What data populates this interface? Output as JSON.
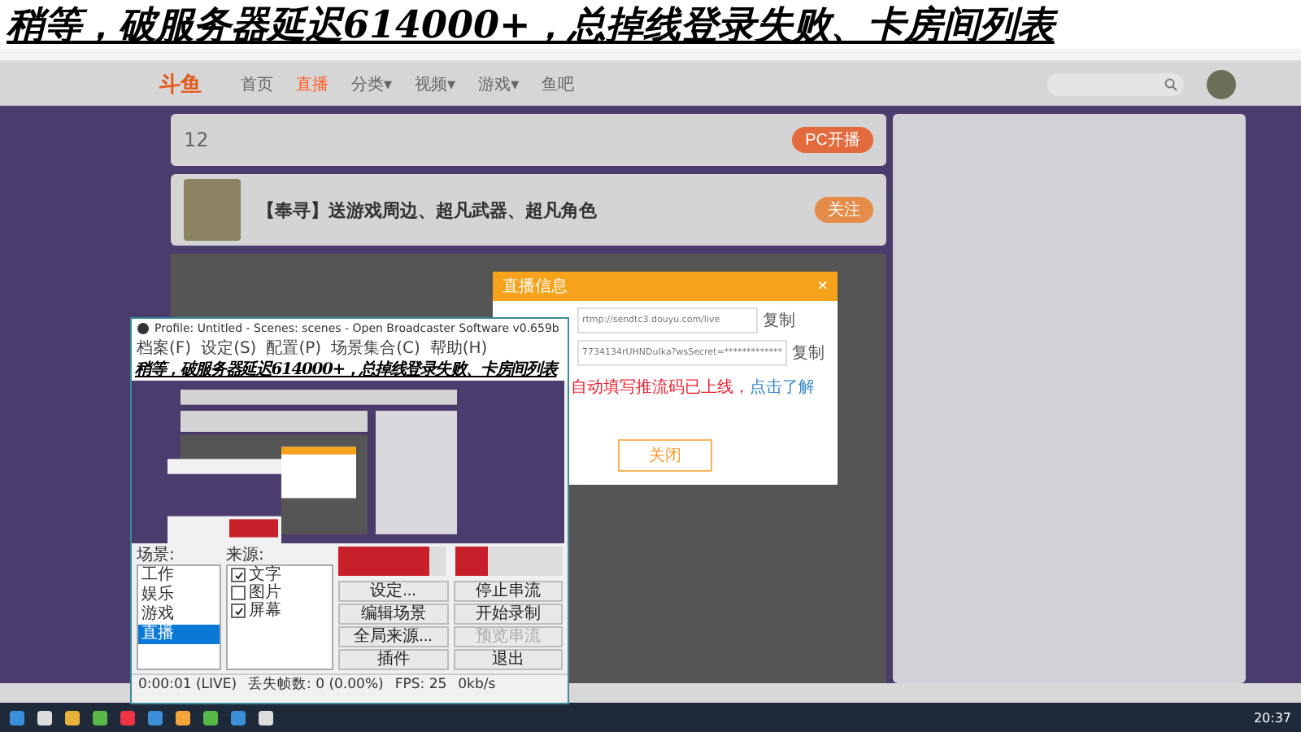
{
  "banner": {
    "text": "稍等，破服务器延迟614000+，总掉线登录失败、卡房间列表"
  },
  "site": {
    "logo": "斗鱼",
    "nav": [
      {
        "label": "首页",
        "selected": false,
        "menu": false
      },
      {
        "label": "直播",
        "selected": true,
        "menu": false
      },
      {
        "label": "分类",
        "selected": false,
        "menu": true
      },
      {
        "label": "视频",
        "selected": false,
        "menu": true
      },
      {
        "label": "游戏",
        "selected": false,
        "menu": true
      },
      {
        "label": "鱼吧",
        "selected": false,
        "menu": false
      }
    ],
    "caret": "▾"
  },
  "category_bar": {
    "count": "12",
    "pc_button": "PC开播"
  },
  "room": {
    "title": "【奉寻】送游戏周边、超凡武器、超凡角色",
    "follow": "关注"
  },
  "dialog": {
    "title": "直播信息",
    "close": "×",
    "url": "rtmp://sendtc3.douyu.com/live",
    "key": "7734134rUHNDuIka?wsSecret=*************",
    "copy": [
      "复制",
      "复制"
    ],
    "notice": "自动填写推流码已上线，",
    "notice_link": "点击了解",
    "button": "关闭"
  },
  "obs": {
    "title": "Profile: Untitled - Scenes: scenes - Open Broadcaster Software v0.659b",
    "menu": [
      "档案(F)",
      "设定(S)",
      "配置(P)",
      "场景集合(C)",
      "帮助(H)"
    ],
    "overlay_text": "稍等，破服务器延迟614000+，总掉线登录失败、卡房间列表",
    "scenes_label": "场景:",
    "sources_label": "来源:",
    "scenes": [
      {
        "label": "工作",
        "selected": false
      },
      {
        "label": "娱乐",
        "selected": false
      },
      {
        "label": "游戏",
        "selected": false
      },
      {
        "label": "直播",
        "selected": true
      }
    ],
    "sources": [
      {
        "label": "文字",
        "checked": true
      },
      {
        "label": "图片",
        "checked": false
      },
      {
        "label": "屏幕",
        "checked": true
      }
    ],
    "meters": [
      {
        "level": 0.85
      },
      {
        "level": 0.3
      }
    ],
    "buttons": [
      {
        "label": "设定...",
        "disabled": false
      },
      {
        "label": "停止串流",
        "disabled": false
      },
      {
        "label": "编辑场景",
        "disabled": false
      },
      {
        "label": "开始录制",
        "disabled": false
      },
      {
        "label": "全局来源...",
        "disabled": false
      },
      {
        "label": "预览串流",
        "disabled": true
      },
      {
        "label": "插件",
        "disabled": false
      },
      {
        "label": "退出",
        "disabled": false
      }
    ],
    "status": [
      "0:00:01 (LIVE)",
      "丢失帧数: 0 (0.00%)",
      "FPS: 25",
      "0kb/s"
    ]
  },
  "taskbar": {
    "time": "20:37"
  }
}
